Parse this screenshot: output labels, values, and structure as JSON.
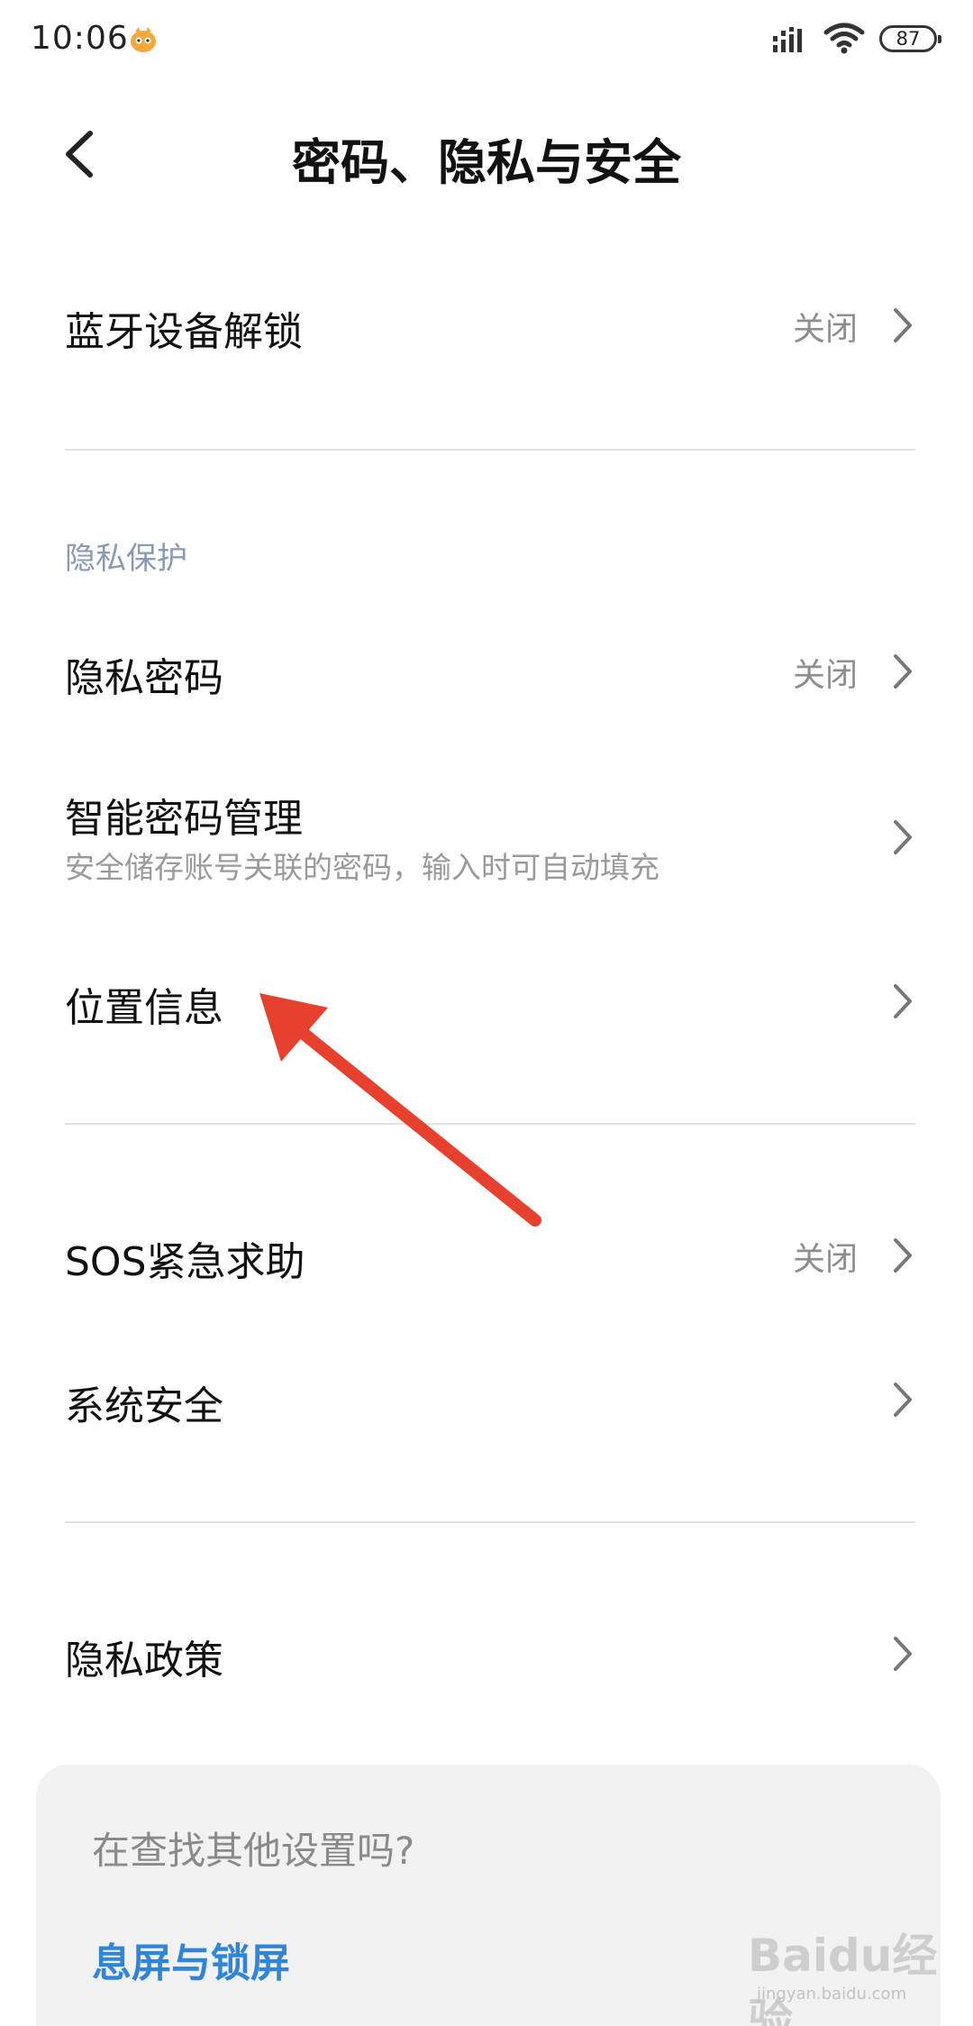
{
  "status_bar": {
    "time": "10:06",
    "battery": "87",
    "icons": [
      "app-notification-icon",
      "signal-icon",
      "wifi-icon",
      "battery-icon"
    ]
  },
  "header": {
    "title": "密码、隐私与安全",
    "back_icon": "chevron-left-icon"
  },
  "rows": {
    "bluetooth_unlock": {
      "title": "蓝牙设备解锁",
      "value": "关闭"
    },
    "privacy_password": {
      "title": "隐私密码",
      "value": "关闭"
    },
    "smart_password": {
      "title": "智能密码管理",
      "subtitle": "安全储存账号关联的密码，输入时可自动填充"
    },
    "location": {
      "title": "位置信息"
    },
    "sos": {
      "title": "SOS紧急求助",
      "value": "关闭"
    },
    "system_security": {
      "title": "系统安全"
    },
    "privacy_policy": {
      "title": "隐私政策"
    }
  },
  "sections": {
    "privacy_protection": "隐私保护"
  },
  "suggestion": {
    "prompt": "在查找其他设置吗?",
    "link": "息屏与锁屏"
  },
  "watermark": {
    "brand": "Baidu经验",
    "url": "jingyan.baidu.com"
  },
  "colors": {
    "accent_link": "#2f86d8",
    "annotation_arrow": "#e8402f",
    "section_header": "#8a9ab0",
    "secondary_text": "#8e8e8e"
  }
}
